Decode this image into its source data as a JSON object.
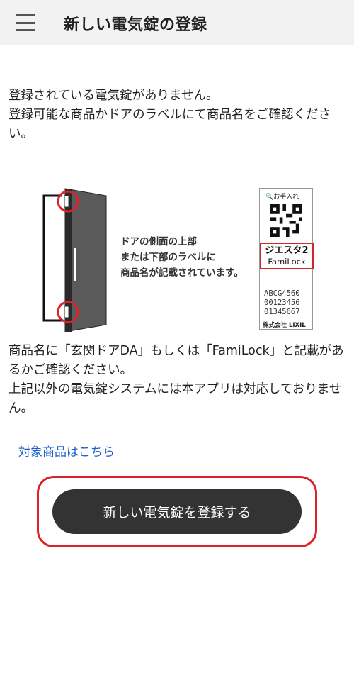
{
  "header": {
    "menu_icon": "hamburger-menu-icon",
    "title": "新しい電気錠の登録"
  },
  "intro": {
    "line1": "登録されている電気錠がありません。",
    "line2": "登録可能な商品かドアのラベルにて商品名をご確認ください。"
  },
  "illustration": {
    "caption_lines": [
      "ドアの側面の上部",
      "または下部のラベルに",
      "商品名が記載されています。"
    ],
    "label": {
      "care": "お手入れ",
      "product_jp": "ジエスタ2",
      "product_en": "FamiLock",
      "codes": [
        "ABCG4560",
        "00123456",
        "01345667"
      ],
      "maker": "株式会社 LIXIL"
    }
  },
  "note": {
    "line1": "商品名に「玄関ドアDA」もしくは「FamiLock」と記載があるかご確認ください。",
    "line2": "上記以外の電気錠システムには本アプリは対応しておりません。"
  },
  "link_label": "対象商品はこちら",
  "button_label": "新しい電気錠を登録する",
  "colors": {
    "app_bar": "#f2f2f2",
    "highlight_red": "#d9222a",
    "link_blue": "#1f5fcf",
    "button_dark": "#333333"
  }
}
